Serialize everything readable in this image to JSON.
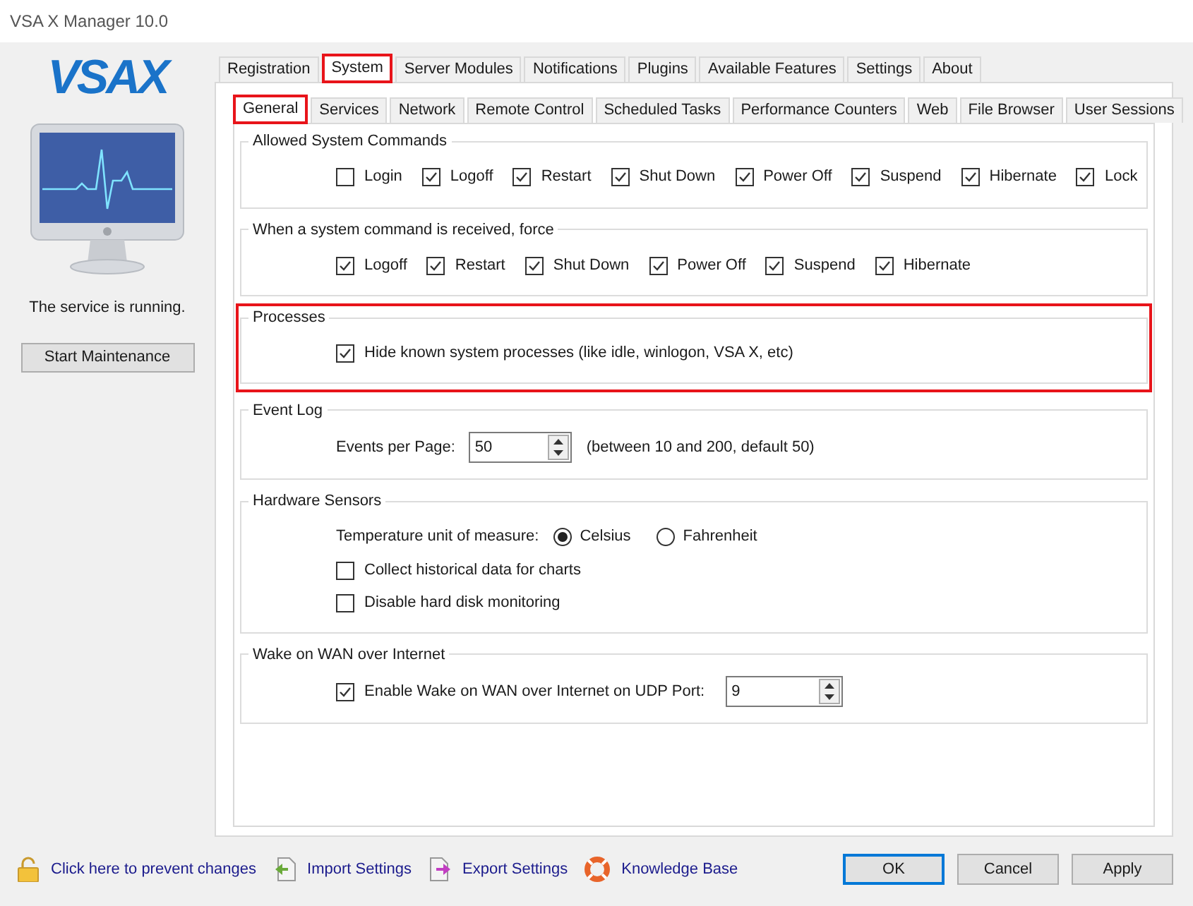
{
  "window": {
    "title": "VSA X Manager 10.0"
  },
  "sidebar": {
    "logo": "VSAX",
    "status": "The service is running.",
    "button": "Start Maintenance"
  },
  "tabs": [
    {
      "label": "Registration",
      "selected": false,
      "highlighted": false
    },
    {
      "label": "System",
      "selected": true,
      "highlighted": true
    },
    {
      "label": "Server Modules",
      "selected": false,
      "highlighted": false
    },
    {
      "label": "Notifications",
      "selected": false,
      "highlighted": false
    },
    {
      "label": "Plugins",
      "selected": false,
      "highlighted": false
    },
    {
      "label": "Available Features",
      "selected": false,
      "highlighted": false
    },
    {
      "label": "Settings",
      "selected": false,
      "highlighted": false
    },
    {
      "label": "About",
      "selected": false,
      "highlighted": false
    }
  ],
  "subtabs": [
    {
      "label": "General",
      "selected": true,
      "highlighted": true
    },
    {
      "label": "Services",
      "selected": false,
      "highlighted": false
    },
    {
      "label": "Network",
      "selected": false,
      "highlighted": false
    },
    {
      "label": "Remote Control",
      "selected": false,
      "highlighted": false
    },
    {
      "label": "Scheduled Tasks",
      "selected": false,
      "highlighted": false
    },
    {
      "label": "Performance Counters",
      "selected": false,
      "highlighted": false
    },
    {
      "label": "Web",
      "selected": false,
      "highlighted": false
    },
    {
      "label": "File Browser",
      "selected": false,
      "highlighted": false
    },
    {
      "label": "User Sessions",
      "selected": false,
      "highlighted": false
    }
  ],
  "groups": [
    {
      "title": "Allowed System Commands",
      "highlighted": false,
      "rows": [
        {
          "kind": "checkboxes",
          "items": [
            {
              "label": "Login",
              "checked": false
            },
            {
              "label": "Logoff",
              "checked": true
            },
            {
              "label": "Restart",
              "checked": true
            },
            {
              "label": "Shut Down",
              "checked": true
            },
            {
              "label": "Power Off",
              "checked": true
            },
            {
              "label": "Suspend",
              "checked": true
            },
            {
              "label": "Hibernate",
              "checked": true
            },
            {
              "label": "Lock",
              "checked": true
            }
          ]
        }
      ]
    },
    {
      "title": "When a system command is received, force",
      "highlighted": false,
      "rows": [
        {
          "kind": "checkboxes",
          "items": [
            {
              "label": "Logoff",
              "checked": true
            },
            {
              "label": "Restart",
              "checked": true
            },
            {
              "label": "Shut Down",
              "checked": true
            },
            {
              "label": "Power Off",
              "checked": true
            },
            {
              "label": "Suspend",
              "checked": true
            },
            {
              "label": "Hibernate",
              "checked": true
            }
          ]
        }
      ]
    },
    {
      "title": "Processes",
      "highlighted": true,
      "rows": [
        {
          "kind": "checkbox",
          "label": "Hide known system processes (like idle, winlogon, VSA X, etc)",
          "checked": true
        }
      ]
    },
    {
      "title": "Event Log",
      "highlighted": false,
      "rows": [
        {
          "kind": "spinner",
          "label": "Events per Page:",
          "value": "50",
          "note": "(between 10 and 200, default 50)"
        }
      ]
    },
    {
      "title": "Hardware Sensors",
      "highlighted": false,
      "rows": [
        {
          "kind": "radios",
          "label": "Temperature unit of measure:",
          "options": [
            {
              "label": "Celsius",
              "selected": true
            },
            {
              "label": "Fahrenheit",
              "selected": false
            }
          ]
        },
        {
          "kind": "checkbox",
          "label": "Collect historical data for charts",
          "checked": false
        },
        {
          "kind": "checkbox",
          "label": "Disable hard disk monitoring",
          "checked": false
        }
      ]
    },
    {
      "title": "Wake on WAN over Internet",
      "highlighted": false,
      "rows": [
        {
          "kind": "checkbox_spinner",
          "label": "Enable Wake on WAN over Internet on UDP Port:",
          "checked": true,
          "value": "9"
        }
      ]
    }
  ],
  "footer": {
    "links": [
      {
        "kind": "lock",
        "label": "Click here to prevent changes"
      },
      {
        "kind": "import",
        "label": "Import Settings"
      },
      {
        "kind": "export",
        "label": "Export Settings"
      },
      {
        "kind": "help",
        "label": "Knowledge Base"
      }
    ],
    "buttons": [
      {
        "label": "OK",
        "default": true
      },
      {
        "label": "Cancel",
        "default": false
      },
      {
        "label": "Apply",
        "default": false
      }
    ]
  }
}
